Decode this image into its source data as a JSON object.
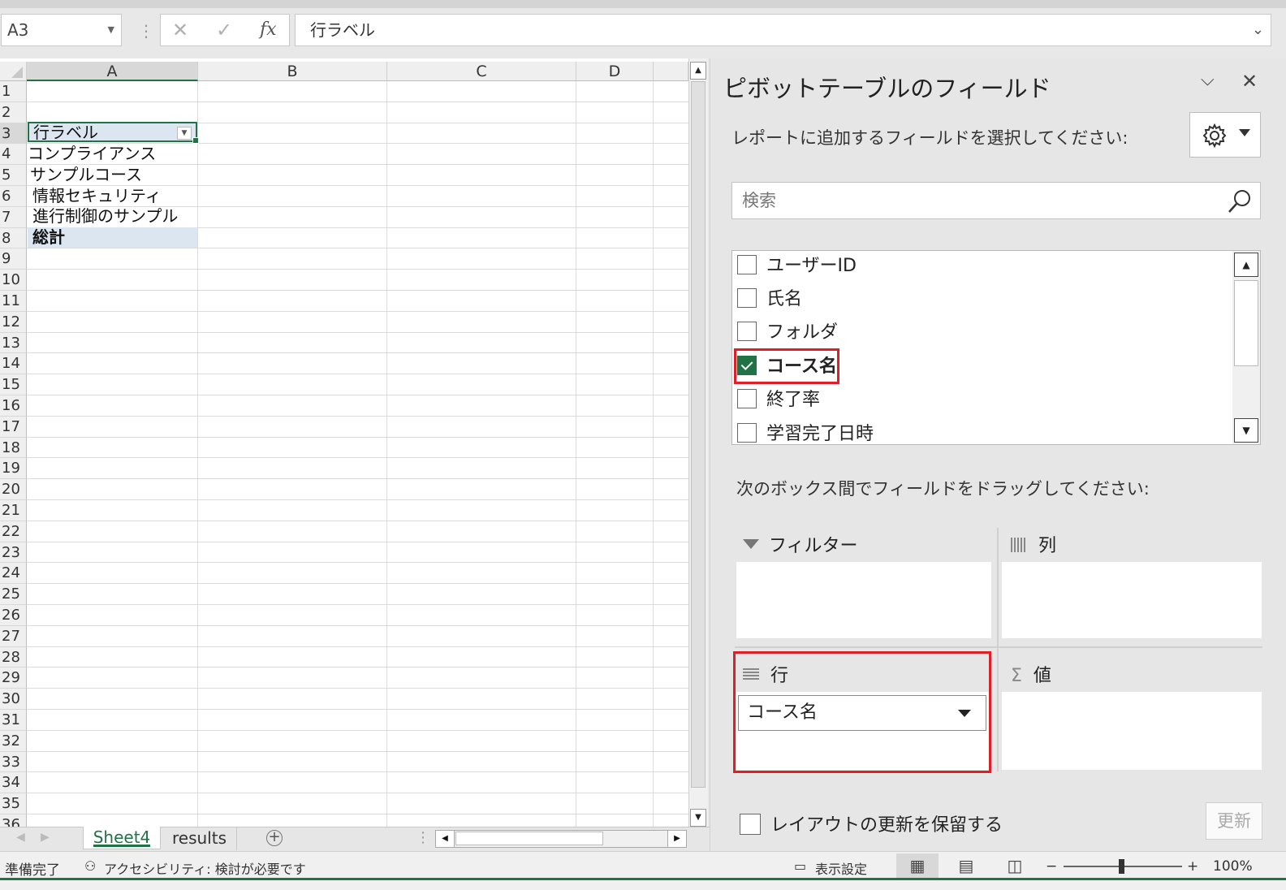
{
  "formula_bar": {
    "name_box": "A3",
    "formula": "行ラベル",
    "cancel_glyph": "✕",
    "enter_glyph": "✓",
    "fx_label": "fx"
  },
  "grid": {
    "columns": [
      "A",
      "B",
      "C",
      "D"
    ],
    "rows": [
      "1",
      "2",
      "3",
      "4",
      "5",
      "6",
      "7",
      "8",
      "9",
      "10",
      "11",
      "12",
      "13",
      "14",
      "15",
      "16",
      "17",
      "18",
      "19",
      "20",
      "21",
      "22",
      "23",
      "24",
      "25",
      "26",
      "27",
      "28",
      "29",
      "30",
      "31",
      "32",
      "33",
      "34",
      "35",
      "36"
    ],
    "cells": {
      "A3": "行ラベル",
      "A4": "コンプライアンス",
      "A5": "サンプルコース",
      "A6": "情報セキュリティ",
      "A7": "進行制御のサンプル",
      "A8": "総計"
    }
  },
  "sheet_tabs": [
    "Sheet4",
    "results"
  ],
  "status_bar": {
    "ready": "準備完了",
    "accessibility": "アクセシビリティ: 検討が必要です",
    "display_settings": "表示設定",
    "zoom": "100%",
    "zoom_minus": "−",
    "zoom_plus": "+"
  },
  "pivot_pane": {
    "title": "ピボットテーブルのフィールド",
    "subtitle": "レポートに追加するフィールドを選択してください:",
    "search_placeholder": "検索",
    "fields": [
      {
        "label": "ユーザーID",
        "checked": false
      },
      {
        "label": "氏名",
        "checked": false
      },
      {
        "label": "フォルダ",
        "checked": false
      },
      {
        "label": "コース名",
        "checked": true
      },
      {
        "label": "終了率",
        "checked": false
      },
      {
        "label": "学習完了日時",
        "checked": false
      }
    ],
    "drag_instruction": "次のボックス間でフィールドをドラッグしてください:",
    "areas": {
      "filter": "フィルター",
      "columns": "列",
      "rows": "行",
      "values": "値"
    },
    "row_field": "コース名",
    "defer_update": "レイアウトの更新を保留する",
    "update_button": "更新"
  },
  "colors": {
    "excel_green": "#217346",
    "highlight_red": "#e01e28",
    "selection_fill": "#dce6f1"
  }
}
